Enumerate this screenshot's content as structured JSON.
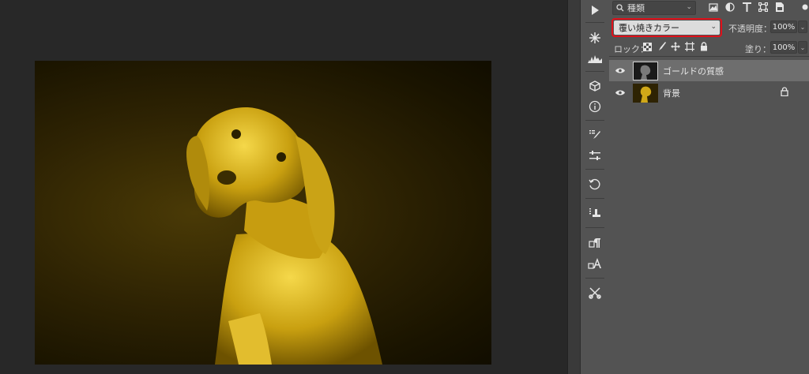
{
  "layers_panel": {
    "filter_kind": "種類",
    "blend_mode": "覆い焼きカラー",
    "opacity_label": "不透明度：",
    "opacity_value": "100%",
    "lock_label": "ロック：",
    "fill_label": "塗り：",
    "fill_value": "100%",
    "layers": [
      {
        "name": "ゴールドの質感",
        "selected": true
      },
      {
        "name": "背景",
        "locked": true
      }
    ]
  },
  "tool_icons": [
    "play-icon",
    "snowflake-icon",
    "histogram-icon",
    "cube-icon",
    "info-icon",
    "brush-presets-icon",
    "adjustments-icon",
    "history-icon",
    "clone-source-icon",
    "paragraph-icon",
    "character-icon",
    "tool-presets-icon"
  ],
  "colors": {
    "highlight": "#e0101a",
    "gold": "#e0b81e"
  }
}
